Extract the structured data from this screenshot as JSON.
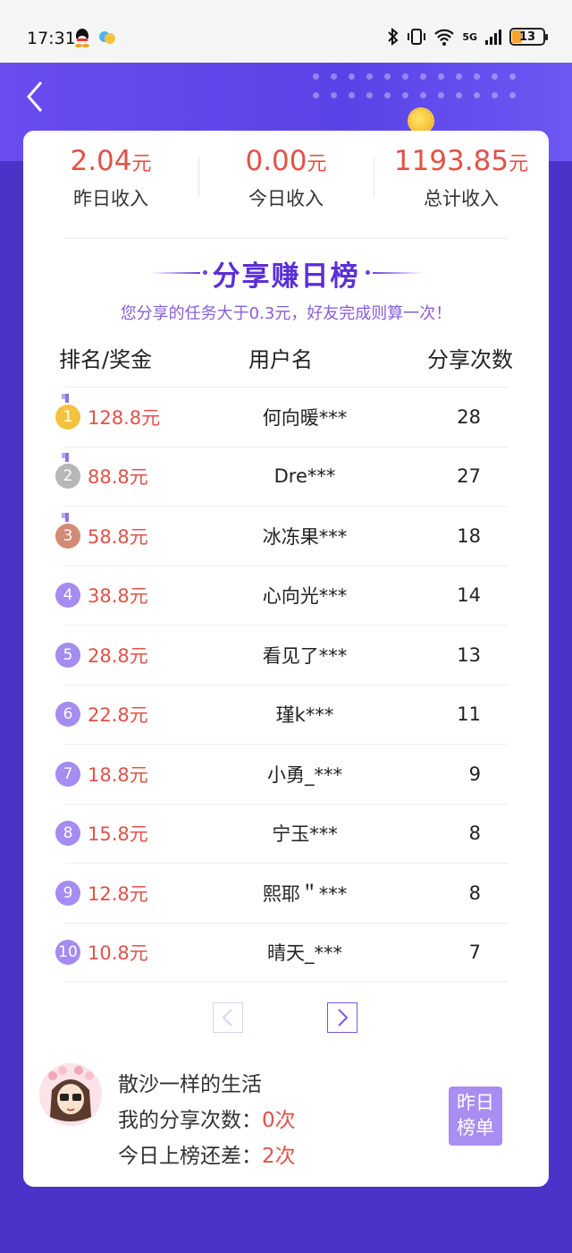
{
  "status_bar": {
    "time": "17:31",
    "battery": "13",
    "network": "5G"
  },
  "header": {
    "back_icon": "chevron-left-icon"
  },
  "stats": [
    {
      "value": "2.04",
      "unit": "元",
      "label": "昨日收入"
    },
    {
      "value": "0.00",
      "unit": "元",
      "label": "今日收入"
    },
    {
      "value": "1193.85",
      "unit": "元",
      "label": "总计收入"
    }
  ],
  "leaderboard": {
    "title": "分享赚日榜",
    "subtitle": "您分享的任务大于0.3元，好友完成则算一次！",
    "columns": {
      "rank": "排名/奖金",
      "user": "用户名",
      "count": "分享次数"
    },
    "rows": [
      {
        "rank": "1",
        "prize": "128.8元",
        "user": "何向暖***",
        "count": "28",
        "color": "#f3c33f"
      },
      {
        "rank": "2",
        "prize": "88.8元",
        "user": "Dre***",
        "count": "27",
        "color": "#b7b7b7"
      },
      {
        "rank": "3",
        "prize": "58.8元",
        "user": "冰冻果***",
        "count": "18",
        "color": "#d28b75"
      },
      {
        "rank": "4",
        "prize": "38.8元",
        "user": "心向光***",
        "count": "14",
        "color": "#a48cf0"
      },
      {
        "rank": "5",
        "prize": "28.8元",
        "user": "看见了***",
        "count": "13",
        "color": "#a48cf0"
      },
      {
        "rank": "6",
        "prize": "22.8元",
        "user": "瑾k***",
        "count": "11",
        "color": "#a48cf0"
      },
      {
        "rank": "7",
        "prize": "18.8元",
        "user": "小勇_***",
        "count": "9",
        "color": "#a48cf0"
      },
      {
        "rank": "8",
        "prize": "15.8元",
        "user": "宁玉***",
        "count": "8",
        "color": "#a48cf0"
      },
      {
        "rank": "9",
        "prize": "12.8元",
        "user": "熙耶＂***",
        "count": "8",
        "color": "#a48cf0"
      },
      {
        "rank": "10",
        "prize": "10.8元",
        "user": "晴天_***",
        "count": "7",
        "color": "#a48cf0"
      }
    ]
  },
  "me": {
    "name": "散沙一样的生活",
    "share_label": "我的分享次数：",
    "share_value": "0次",
    "gap_label": "今日上榜还差：",
    "gap_value": "2次",
    "yesterday_button": "昨日榜单"
  }
}
